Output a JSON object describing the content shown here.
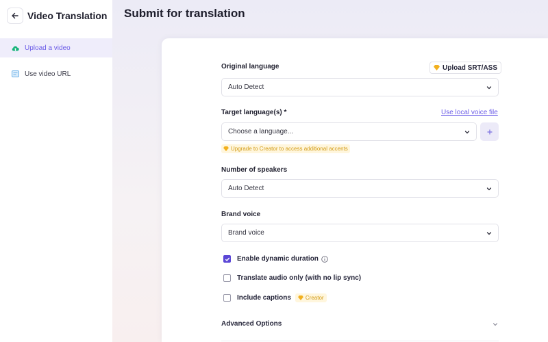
{
  "sidebar": {
    "title": "Video Translation",
    "items": [
      {
        "label": "Upload a video",
        "icon": "cloud-upload-icon",
        "active": true
      },
      {
        "label": "Use video URL",
        "icon": "video-url-icon",
        "active": false
      }
    ]
  },
  "main": {
    "title": "Submit for translation"
  },
  "form": {
    "original_language": {
      "label": "Original language",
      "value": "Auto Detect",
      "upload_button": "Upload SRT/ASS"
    },
    "target_language": {
      "label": "Target language(s) *",
      "placeholder": "Choose a language...",
      "local_voice_link": "Use local voice file",
      "upgrade_note": "Upgrade to Creator to access additional accents"
    },
    "speakers": {
      "label": "Number of speakers",
      "value": "Auto Detect"
    },
    "brand_voice": {
      "label": "Brand voice",
      "value": "Brand voice"
    },
    "options": [
      {
        "label": "Enable dynamic duration",
        "checked": true,
        "has_info": true
      },
      {
        "label": "Translate audio only (with no lip sync)",
        "checked": false
      },
      {
        "label": "Include captions",
        "checked": false,
        "badge": "Creator"
      }
    ],
    "advanced_label": "Advanced Options"
  },
  "colors": {
    "accent": "#6b5ce7",
    "checkbox_checked": "#5b47d6",
    "premium": "#f2b01e"
  }
}
